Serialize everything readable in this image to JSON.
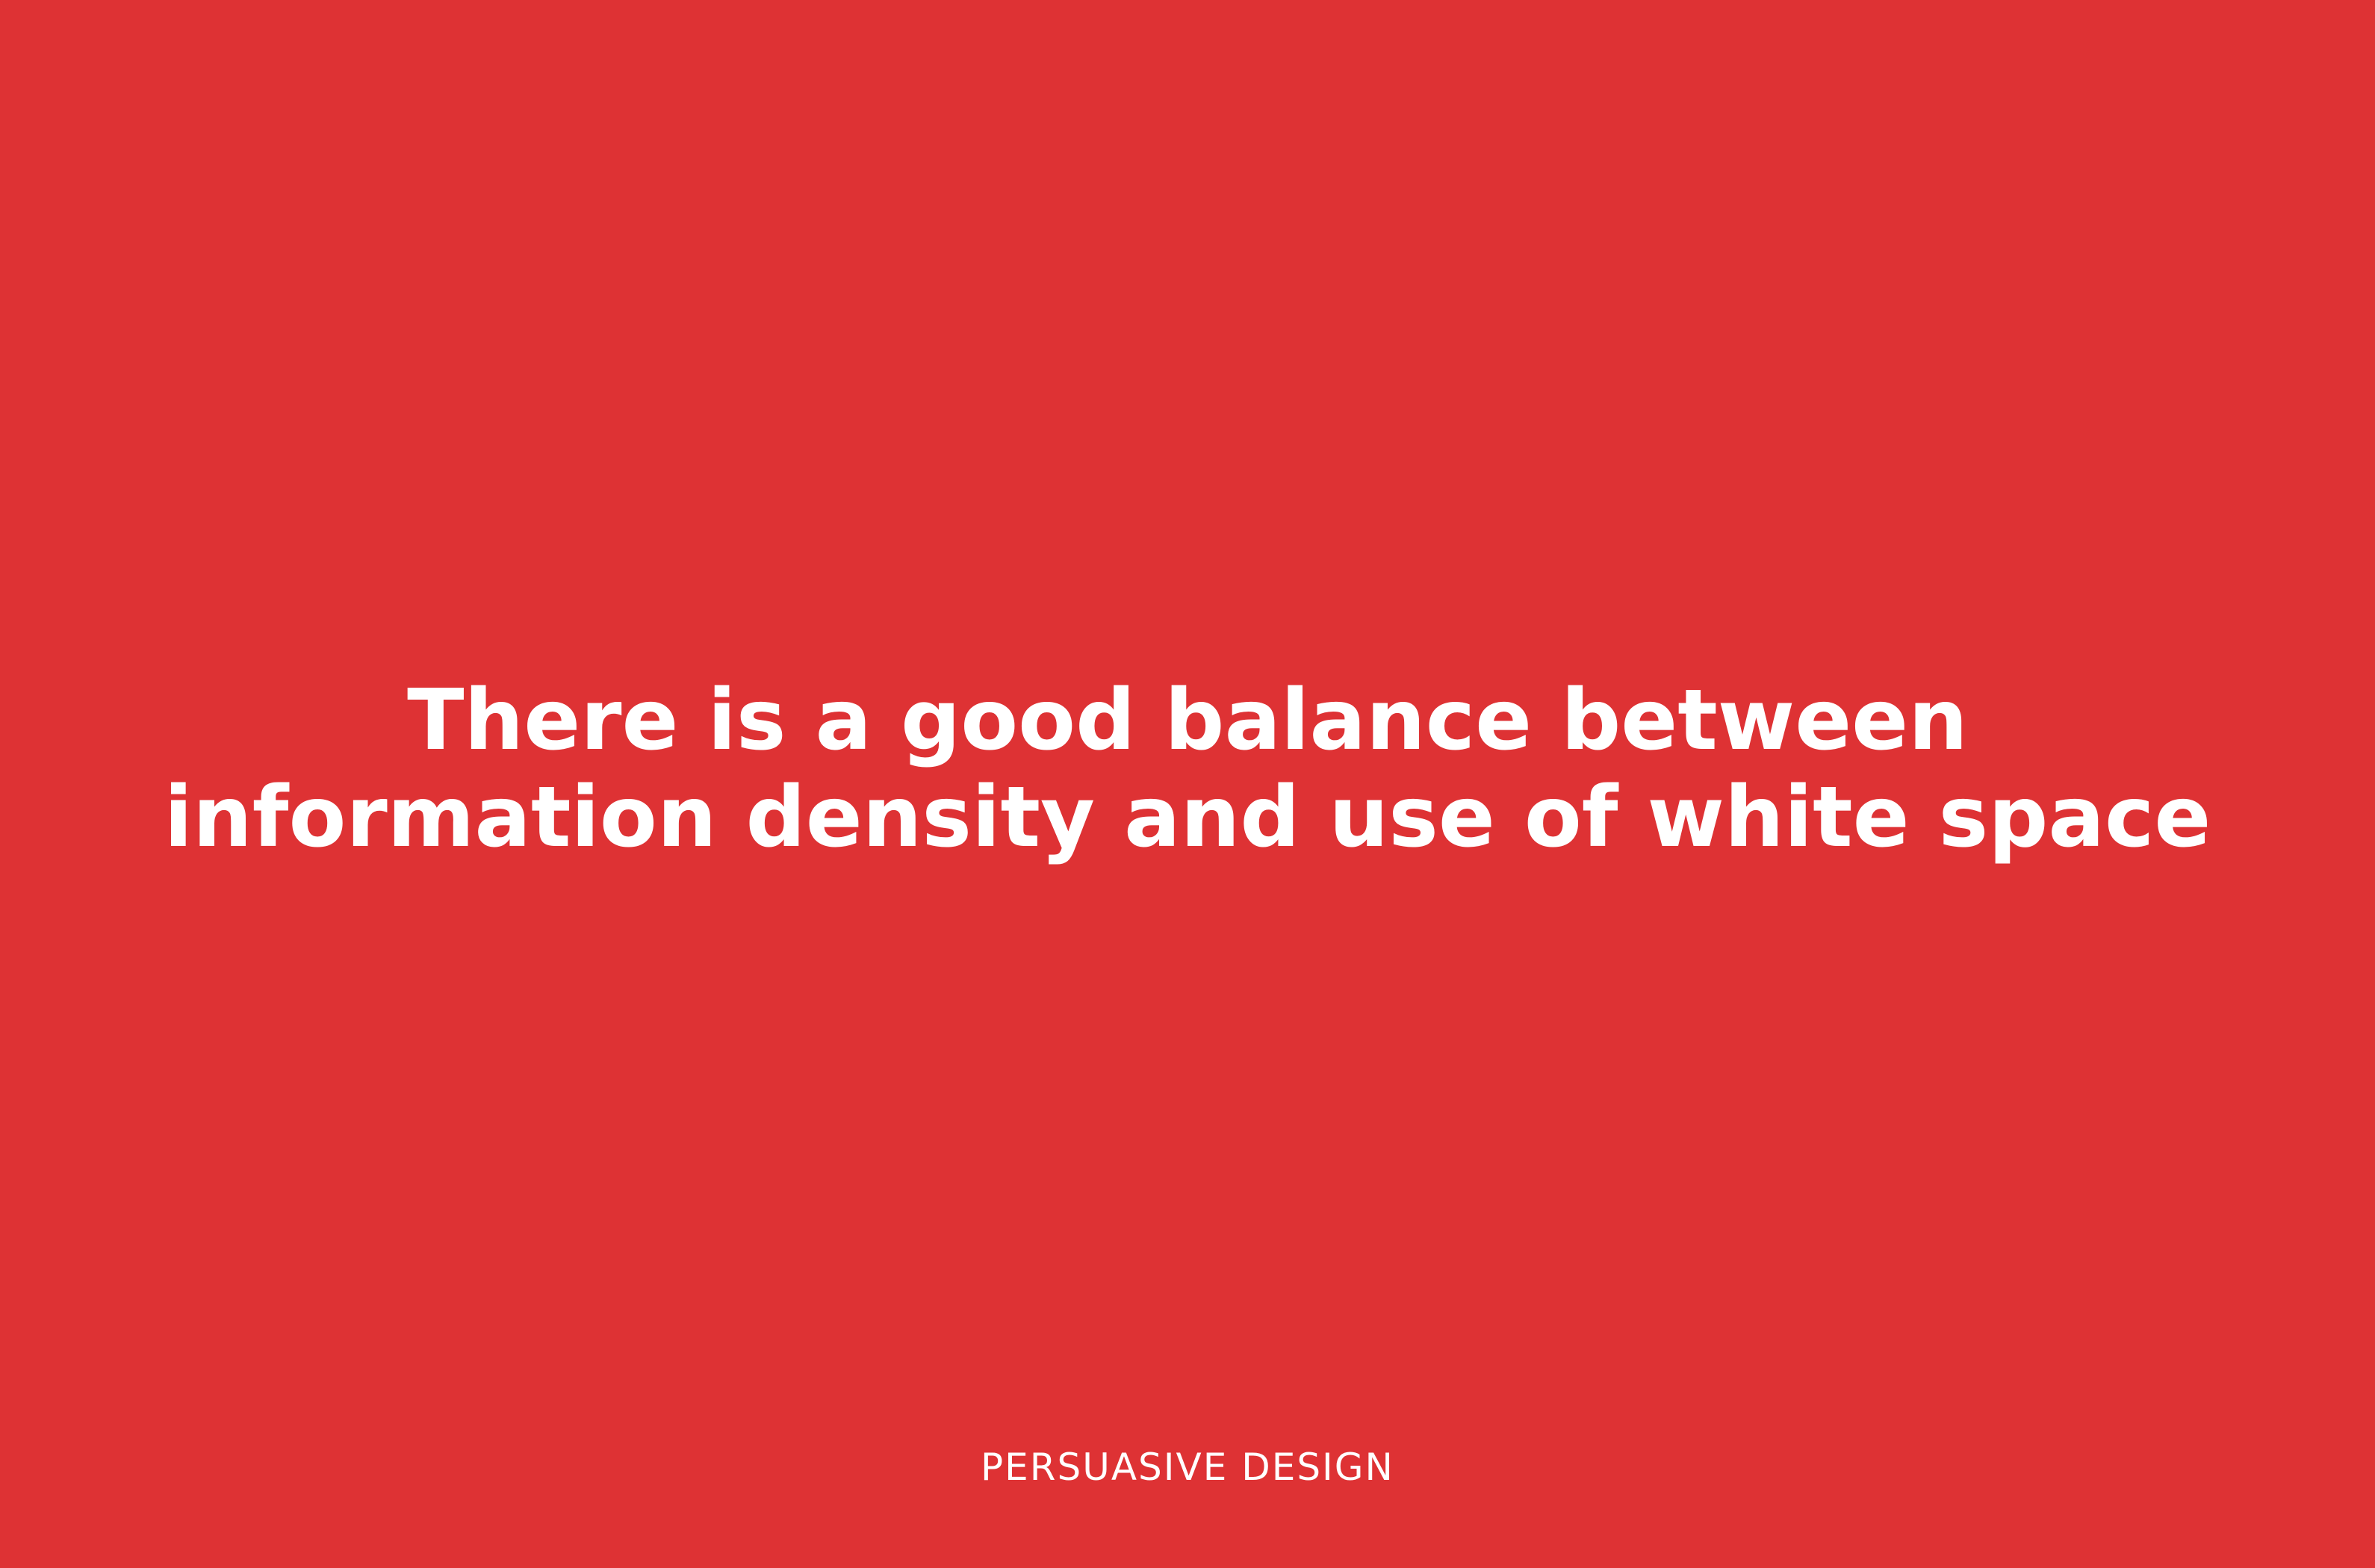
{
  "slide": {
    "headline_lines": [
      "There is a good balance between",
      "information density and use of white space"
    ],
    "footer_label": "PERSUASIVE DESIGN"
  },
  "colors": {
    "background": "#de3234",
    "text": "#ffffff"
  }
}
